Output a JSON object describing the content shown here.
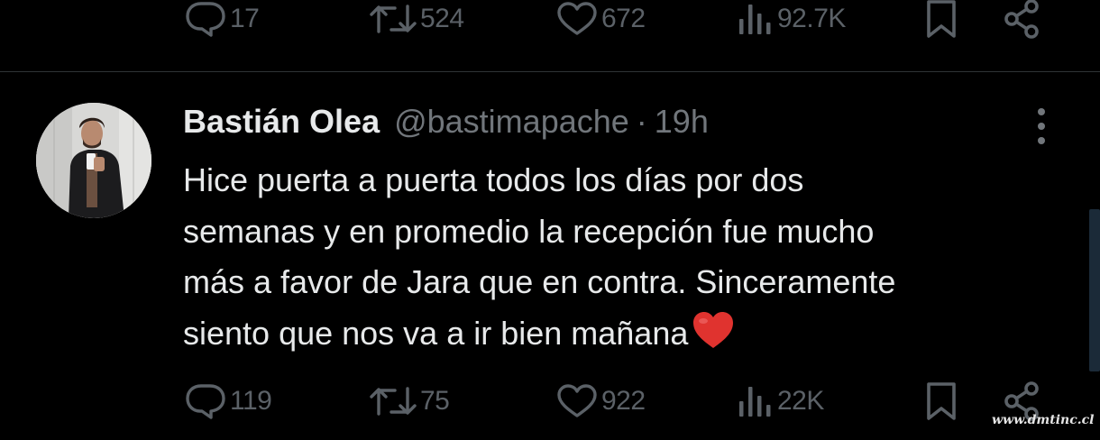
{
  "previous_tweet": {
    "actions": {
      "replies": "17",
      "reposts": "524",
      "likes": "672",
      "views": "92.7K"
    }
  },
  "tweet": {
    "author_name": "Bastián Olea",
    "author_handle": "@bastimapache",
    "separator": "·",
    "timestamp": "19h",
    "text_lines": [
      "Hice puerta a puerta todos los días por dos",
      "semanas y en promedio la recepción fue mucho",
      "más a favor de Jara que en contra. Sinceramente",
      "siento que nos va a ir bien mañana"
    ],
    "emoji": "red-heart",
    "actions": {
      "replies": "119",
      "reposts": "75",
      "likes": "922",
      "views": "22K"
    }
  },
  "watermark": "www.dmtinc.cl",
  "colors": {
    "background": "#000000",
    "text": "#e7e9ea",
    "muted": "#71767b",
    "action_gray": "#5b6167",
    "divider": "#2f3336",
    "heart": "#e0332f"
  }
}
